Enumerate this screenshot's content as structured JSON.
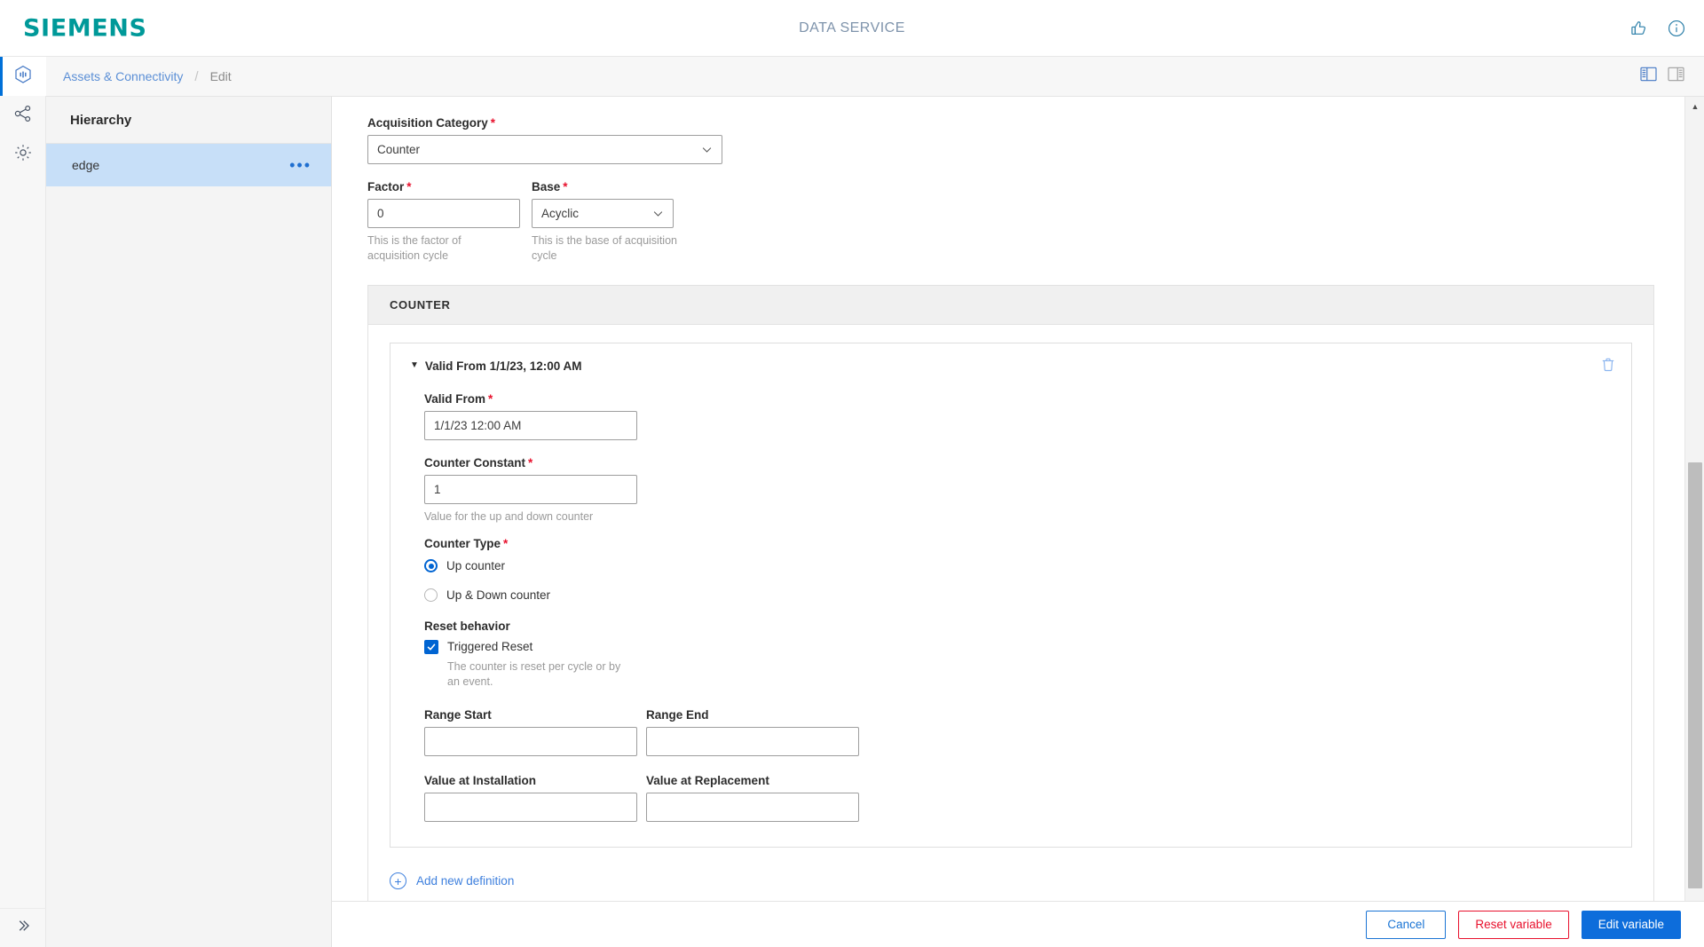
{
  "brand": {
    "logo_text": "SIEMENS",
    "app_title": "DATA SERVICE",
    "feedback_icon": "feedback-thumb-icon",
    "info_icon": "info-icon"
  },
  "rail": {
    "items": [
      {
        "icon": "asset-hexagon-icon",
        "active": true
      },
      {
        "icon": "connectivity-share-icon",
        "active": false
      },
      {
        "icon": "settings-gear-icon",
        "active": false
      }
    ],
    "expand_icon": "chevron-double-right-icon"
  },
  "breadcrumb": {
    "link": "Assets & Connectivity",
    "separator": "/",
    "current": "Edit",
    "layout_left_icon": "panel-layout-left-icon",
    "layout_right_icon": "panel-layout-right-icon"
  },
  "hierarchy": {
    "title": "Hierarchy",
    "nodes": [
      {
        "label": "edge",
        "selected": true,
        "menu_icon": "overflow-menu-icon"
      }
    ]
  },
  "form": {
    "acquisition_category": {
      "label": "Acquisition Category",
      "required": "*",
      "value": "Counter",
      "options": [
        "Counter"
      ]
    },
    "factor": {
      "label": "Factor",
      "required": "*",
      "value": "0",
      "hint": "This is the factor of acquisition cycle"
    },
    "base": {
      "label": "Base",
      "required": "*",
      "value": "Acyclic",
      "options": [
        "Acyclic"
      ],
      "hint": "This is the base of acquisition cycle"
    },
    "counter_section": {
      "heading": "COUNTER",
      "definition": {
        "summary": "Valid From 1/1/23, 12:00 AM",
        "caret": "▼",
        "delete_icon": "trash-icon",
        "valid_from": {
          "label": "Valid From",
          "required": "*",
          "value": "1/1/23 12:00 AM"
        },
        "counter_constant": {
          "label": "Counter Constant",
          "required": "*",
          "value": "1",
          "hint": "Value for the up and down counter"
        },
        "counter_type": {
          "label": "Counter Type",
          "required": "*",
          "options": [
            {
              "label": "Up counter",
              "selected": true
            },
            {
              "label": "Up & Down counter",
              "selected": false
            }
          ]
        },
        "reset_behavior": {
          "label": "Reset behavior",
          "checkbox_label": "Triggered Reset",
          "checked": true,
          "hint": "The counter is reset per cycle or by an event."
        },
        "range_start": {
          "label": "Range Start",
          "value": ""
        },
        "range_end": {
          "label": "Range End",
          "value": ""
        },
        "value_at_installation": {
          "label": "Value at Installation",
          "value": ""
        },
        "value_at_replacement": {
          "label": "Value at Replacement",
          "value": ""
        }
      },
      "add_link": "Add new definition",
      "add_icon": "plus-circle-icon"
    }
  },
  "footer": {
    "cancel": "Cancel",
    "reset": "Reset variable",
    "submit": "Edit variable"
  },
  "colors": {
    "brand_teal": "#009999",
    "accent_blue": "#0d6ddb",
    "danger_red": "#e8112d",
    "selected_row": "#c7dff8"
  }
}
